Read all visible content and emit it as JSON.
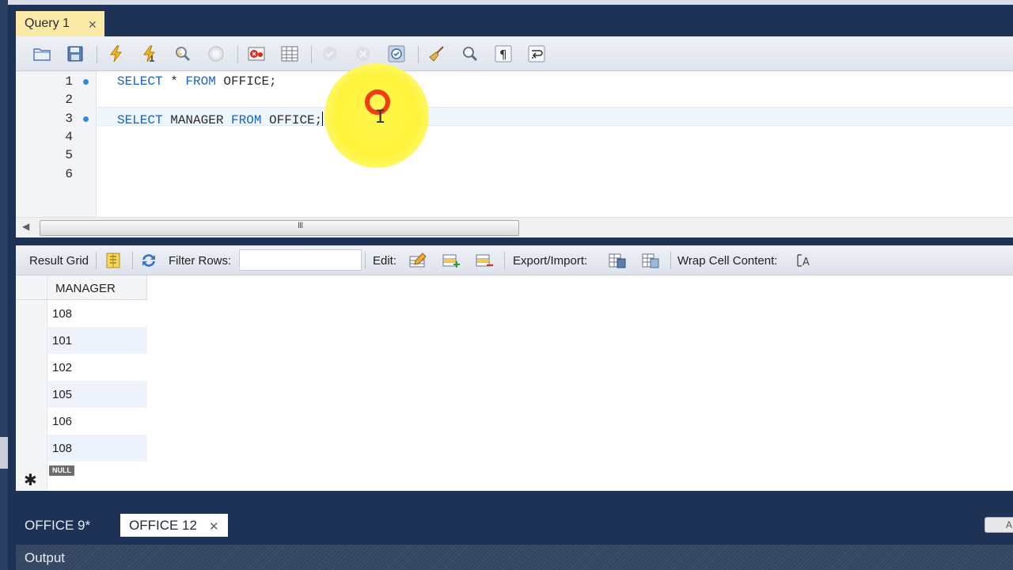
{
  "query_tab": {
    "label": "Query 1",
    "close": "✕"
  },
  "editor": {
    "lines": [
      {
        "num": "1",
        "parts": [
          "SELECT",
          " * ",
          "FROM",
          " OFFICE;"
        ],
        "marker": true
      },
      {
        "num": "2",
        "parts": [],
        "marker": false
      },
      {
        "num": "3",
        "parts": [
          "SELECT",
          " MANAGER ",
          "FROM",
          " OFFICE;"
        ],
        "marker": true
      },
      {
        "num": "4",
        "parts": [],
        "marker": false
      },
      {
        "num": "5",
        "parts": [],
        "marker": false
      },
      {
        "num": "6",
        "parts": [],
        "marker": false
      }
    ],
    "scroll_grip": "III",
    "scroll_left": "◀"
  },
  "result_toolbar": {
    "result_grid": "Result Grid",
    "filter_rows": "Filter Rows:",
    "filter_value": "",
    "edit": "Edit:",
    "export_import": "Export/Import:",
    "wrap_cell": "Wrap Cell Content:"
  },
  "grid": {
    "column": "MANAGER",
    "rows": [
      "108",
      "101",
      "102",
      "105",
      "106",
      "108"
    ],
    "null_label": "NULL",
    "new_row_marker": "✱"
  },
  "bottom_tabs": {
    "inactive": "OFFICE 9*",
    "active": "OFFICE 12",
    "close": "✕",
    "corner": "A"
  },
  "output": {
    "label": "Output"
  },
  "colors": {
    "keyword": "#1763c2",
    "accent_tab": "#fbe9a6",
    "frame": "#1e3256"
  }
}
